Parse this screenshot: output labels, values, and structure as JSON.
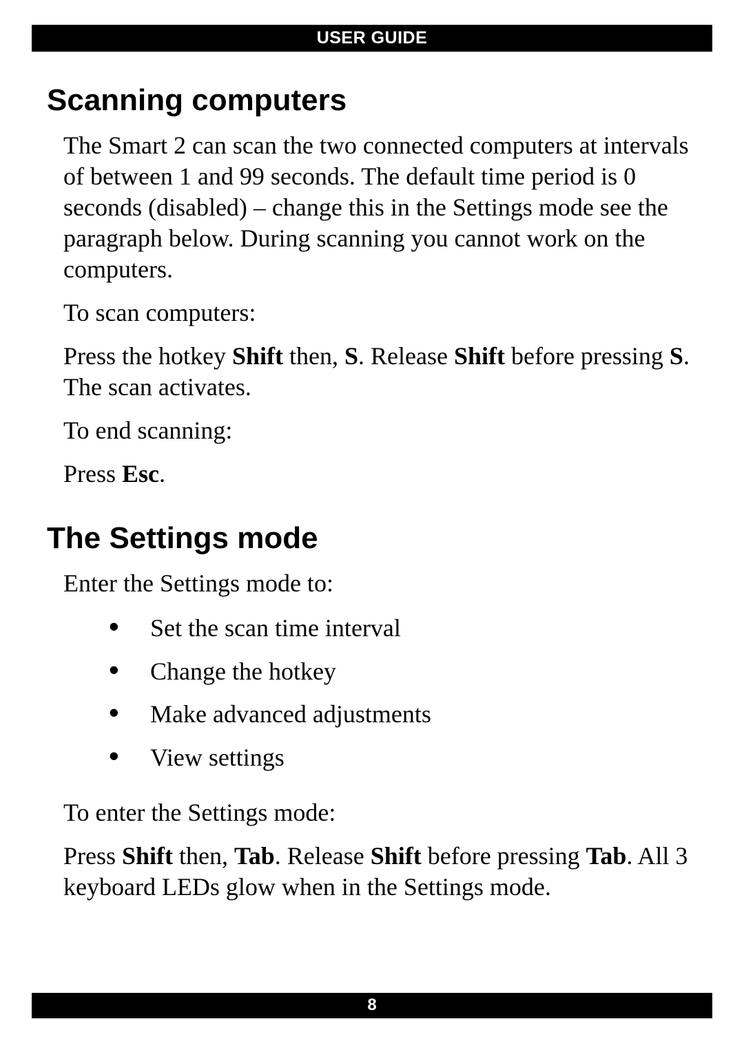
{
  "header": {
    "title": "USER GUIDE"
  },
  "footer": {
    "page_number": "8"
  },
  "sections": {
    "scanning": {
      "heading": "Scanning computers",
      "p1": "The Smart 2 can scan the two connected computers at intervals of between 1 and 99 seconds. The default time period is 0 seconds (disabled) – change this in the Settings mode see the paragraph below. During scanning you cannot work on the computers.",
      "p2": "To scan computers:",
      "p3_parts": {
        "t1": "Press the hotkey ",
        "b1": "Shift",
        "t2": " then, ",
        "b2": "S",
        "t3": ". Release ",
        "b3": "Shift",
        "t4": " before pressing ",
        "b4": "S",
        "t5": ". The scan activates."
      },
      "p4": "To end scanning:",
      "p5_parts": {
        "t1": "Press ",
        "b1": "Esc",
        "t2": "."
      }
    },
    "settings": {
      "heading": "The Settings mode",
      "p1": "Enter the Settings mode to:",
      "bullets": [
        "Set the scan time interval",
        "Change the hotkey",
        "Make advanced adjustments",
        "View settings"
      ],
      "p2": "To enter the Settings mode:",
      "p3_parts": {
        "t1": "Press ",
        "b1": "Shift",
        "t2": " then, ",
        "b2": "Tab",
        "t3": ". Release ",
        "b3": "Shift",
        "t4": " before pressing ",
        "b4": "Tab",
        "t5": ". All 3 keyboard LEDs glow when in the Settings mode."
      }
    }
  }
}
